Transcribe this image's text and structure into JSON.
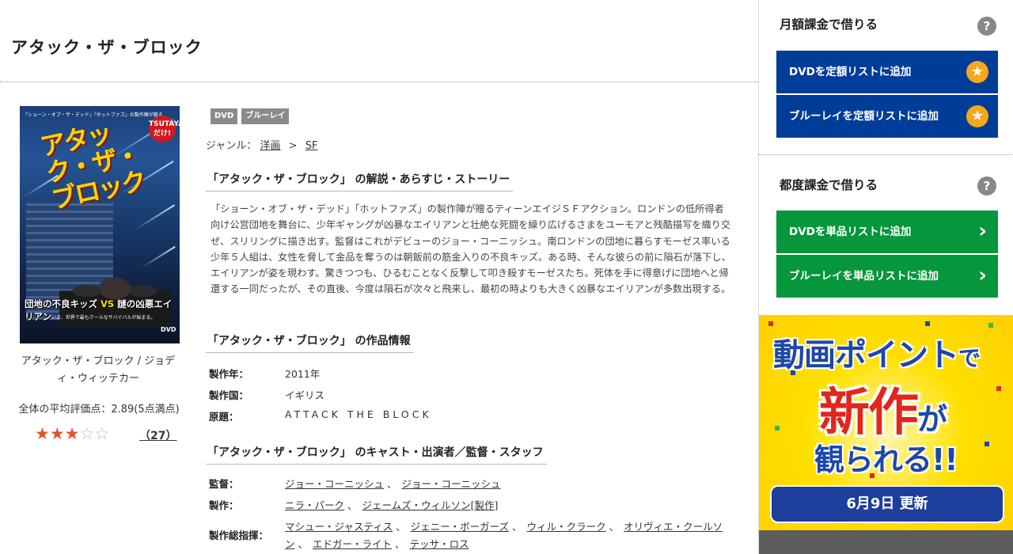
{
  "title": "アタック・ザ・ブロック",
  "poster": {
    "tagline": "『ショーン・オブ・ザ・デッド』『ホットファズ』の製作陣が贈る",
    "title": "アタック・ザ・ブロック",
    "badge": "TSUTAYAだけ!",
    "catch_left": "団地の不良キッズ",
    "catch_vs": "VS",
    "catch_right": "謎の凶悪エイリアン",
    "note": "いま、世界で最もクールなサバイバルが始まる。",
    "dvd": "DVD"
  },
  "caption": "アタック・ザ・ブロック / ジョディ・ウィッテカー",
  "rating": {
    "average_text": "全体の平均評価点：2.89(5点満点)",
    "average": 2.89,
    "max": 5,
    "stars": "★★★☆☆",
    "count": "（27）"
  },
  "tags": [
    "DVD",
    "ブルーレイ"
  ],
  "genre": {
    "label": "ジャンル：",
    "items": [
      "洋画",
      "SF"
    ],
    "separator": ">"
  },
  "synopsis": {
    "heading": "「アタック・ザ・ブロック」 の解説・あらすじ・ストーリー",
    "text": "「ショーン・オブ・ザ・デッド」「ホットファズ」の製作陣が贈るティーンエイジＳＦアクション。ロンドンの低所得者向け公営団地を舞台に、少年ギャングが凶暴なエイリアンと壮絶な死闘を繰り広げるさまをユーモアと残酷描写を織り交ぜ、スリリングに描き出す。監督はこれがデビューのジョー・コーニッシュ。南ロンドンの団地に暮らすモーゼス率いる少年５人組は、女性を脅して金品を奪うのは朝飯前の筋金入りの不良キッズ。ある時、そんな彼らの前に隕石が落下し、エイリアンが姿を現わす。驚きつつも、ひるむことなく反撃して叩き殺すモーゼスたち。死体を手に得意げに団地へと帰還する一同だったが、その直後、今度は隕石が次々と飛来し、最初の時よりも大きく凶暴なエイリアンが多数出現する。"
  },
  "work_info": {
    "heading": "「アタック・ザ・ブロック」 の作品情報",
    "rows": [
      {
        "label": "製作年：",
        "value": "2011年"
      },
      {
        "label": "製作国：",
        "value": "イギリス"
      },
      {
        "label": "原題：",
        "value": "ATTACK THE BLOCK"
      }
    ]
  },
  "cast": {
    "heading": "「アタック・ザ・ブロック」 のキャスト・出演者／監督・スタッフ",
    "rows": [
      {
        "label": "監督：",
        "links": [
          "ジョー・コーニッシュ",
          "ジョー・コーニッシュ"
        ]
      },
      {
        "label": "製作：",
        "links": [
          "ニラ・パーク",
          "ジェームズ・ウィルソン[製作]"
        ]
      },
      {
        "label": "製作総指揮：",
        "links": [
          "マシュー・ジャスティス",
          "ジェニー・ボーガーズ",
          "ウィル・クラーク",
          "オリヴィエ・クールソン",
          "エドガー・ライト",
          "テッサ・ロス"
        ]
      }
    ],
    "separator": "、"
  },
  "sidebar": {
    "monthly": {
      "heading": "月額課金で借りる",
      "help": "?",
      "buttons": [
        "DVDを定額リストに追加",
        "ブルーレイを定額リストに追加"
      ]
    },
    "single": {
      "heading": "都度課金で借りる",
      "help": "?",
      "buttons": [
        "DVDを単品リストに追加",
        "ブルーレイを単品リストに追加"
      ]
    },
    "banner": {
      "line1_a": "動画ポイント",
      "line1_b": "で",
      "line2_a": "新作",
      "line2_b": "が",
      "line3": "観られる!!",
      "date": "6月9日 更新"
    }
  },
  "colors": {
    "monthly_button": "#003d99",
    "single_button": "#06963c",
    "star": "#e2542d",
    "banner_yellow": "#ffe000"
  },
  "icons": {
    "monthly_button_icon": "star-icon",
    "single_button_icon": "chevron-right-icon",
    "help_icon": "question-icon"
  }
}
